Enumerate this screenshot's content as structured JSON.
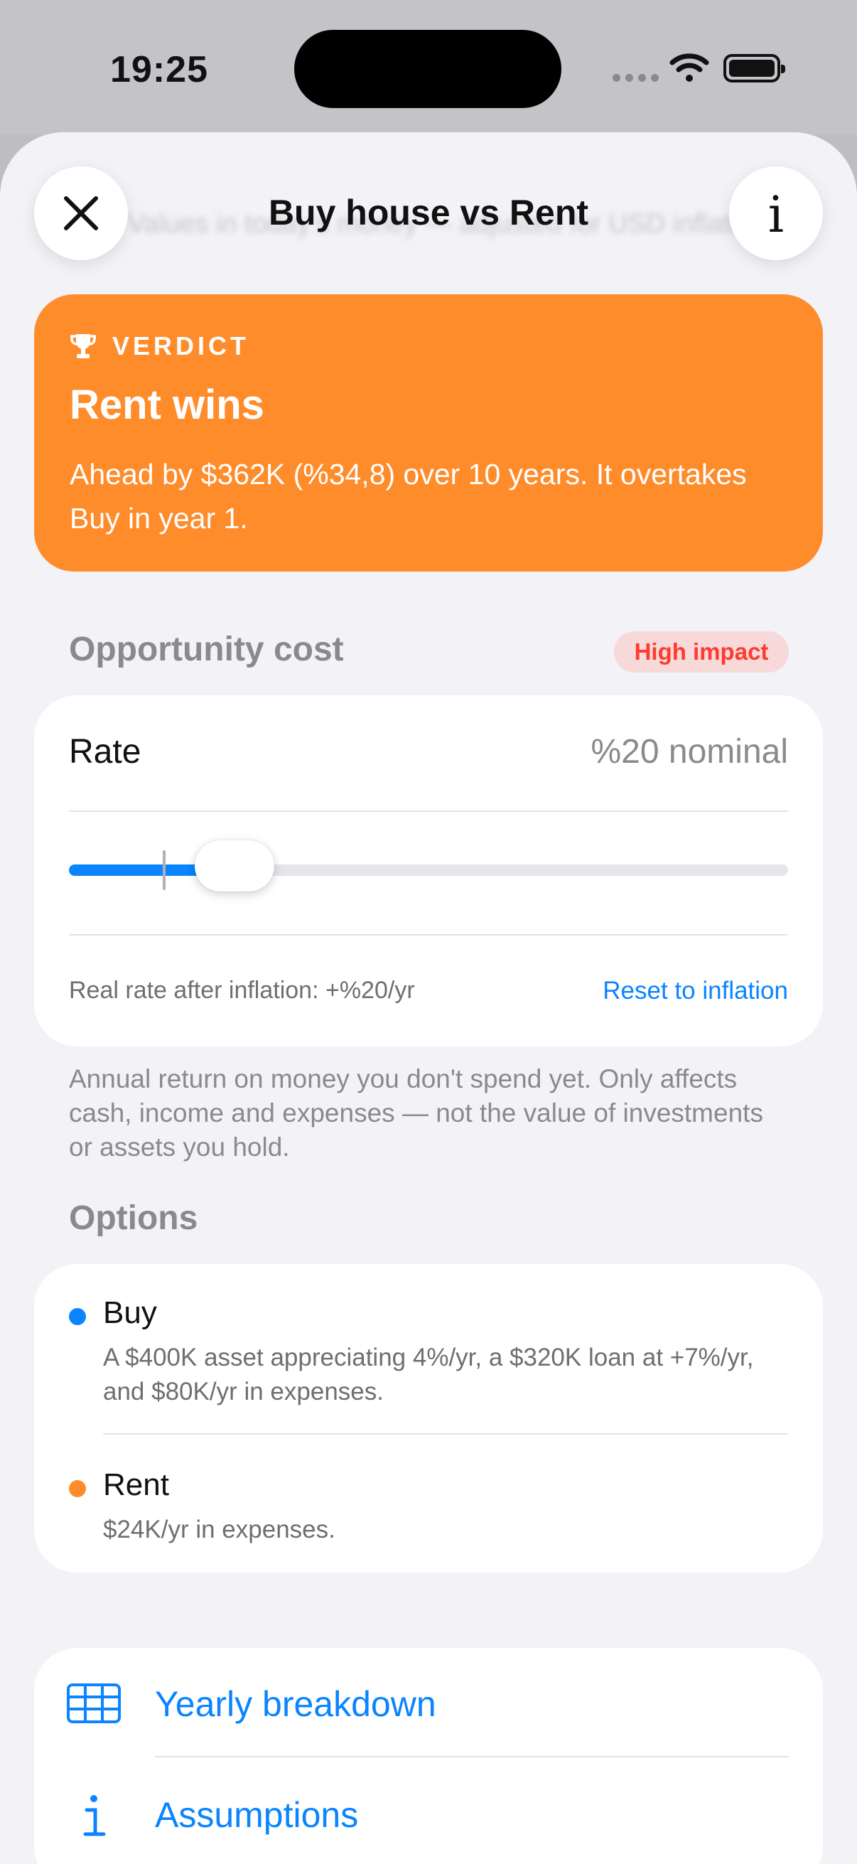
{
  "status_bar": {
    "time": "19:25"
  },
  "background_hint": {
    "subtitle": "Values in today's money — adjusted for USD inflation"
  },
  "nav": {
    "title": "Buy house vs Rent",
    "close_icon": "close-icon",
    "info_icon": "info-icon"
  },
  "verdict": {
    "icon": "trophy-icon",
    "label": "VERDICT",
    "title": "Rent wins",
    "text": "Ahead by $362K (%34,8) over 10 years. It overtakes Buy in year 1.",
    "color": "#ff8c2b"
  },
  "opportunity_cost": {
    "header": "Opportunity cost",
    "badge": "High impact",
    "rate_label": "Rate",
    "rate_value": "%20 nominal",
    "slider": {
      "value_fraction": 0.23,
      "inflation_marker_fraction": 0.13
    },
    "real_rate_text": "Real rate after inflation: +%20/yr",
    "reset_label": "Reset to inflation",
    "footnote": "Annual return on money you don't spend yet. Only affects cash, income and expenses — not the value of investments or assets you hold."
  },
  "options": {
    "header": "Options",
    "items": [
      {
        "name": "Buy",
        "color": "#0a84ff",
        "description": "A $400K asset appreciating 4%/yr, a $320K loan at +7%/yr, and $80K/yr in expenses."
      },
      {
        "name": "Rent",
        "color": "#ff8c2b",
        "description": "$24K/yr in expenses."
      }
    ]
  },
  "links": [
    {
      "label": "Yearly breakdown",
      "icon": "table-icon"
    },
    {
      "label": "Assumptions",
      "icon": "info-icon"
    }
  ],
  "colors": {
    "accent": "#0a84ff",
    "danger": "#ff3b30"
  }
}
